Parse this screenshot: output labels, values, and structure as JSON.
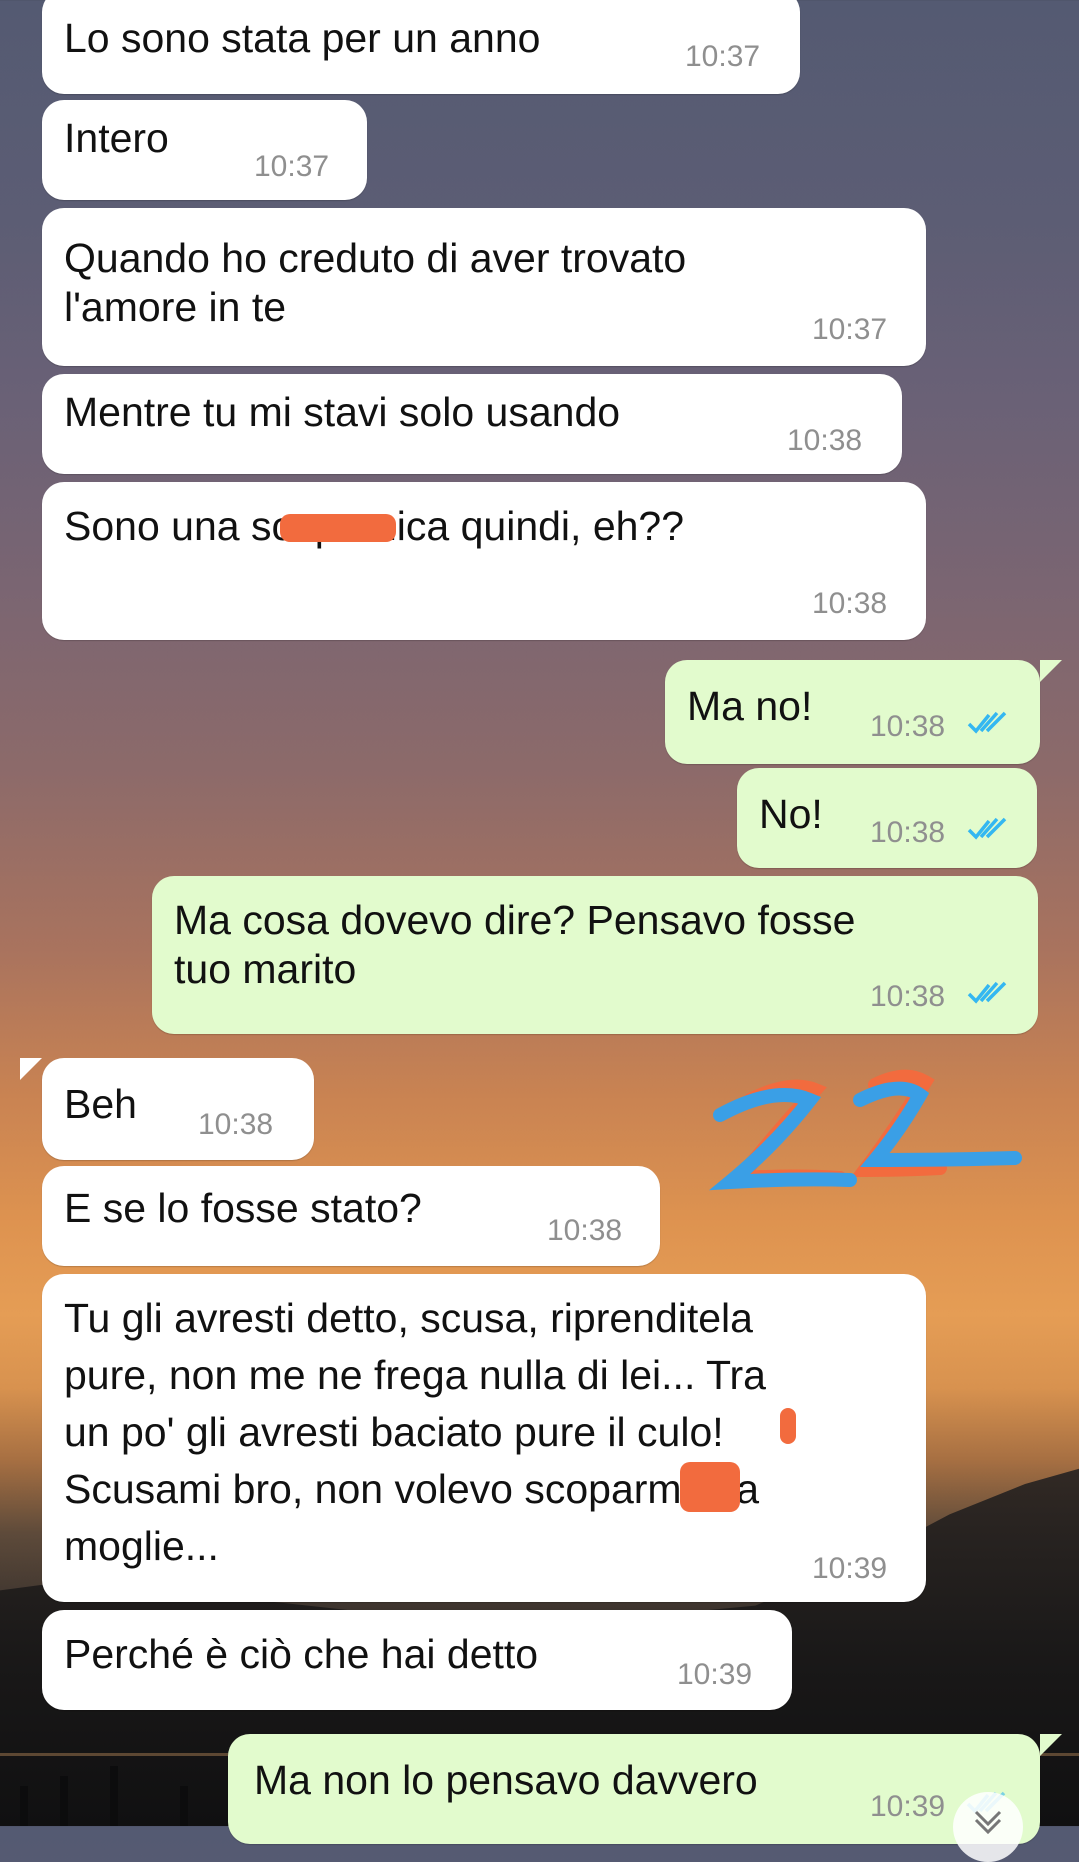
{
  "messages": [
    {
      "dir": "in",
      "text": "Lo sono stata per un anno",
      "time": "10:37"
    },
    {
      "dir": "in",
      "text": "Intero",
      "time": "10:37"
    },
    {
      "dir": "in",
      "text": "Quando ho creduto di aver trovato\nl'amore in te",
      "time": "10:37"
    },
    {
      "dir": "in",
      "text": "Mentre tu mi stavi solo usando",
      "time": "10:38"
    },
    {
      "dir": "in",
      "text": "Sono una scoparnica quindi, eh??",
      "time": "10:38"
    },
    {
      "dir": "out",
      "text": "Ma no!",
      "time": "10:38",
      "status": "read"
    },
    {
      "dir": "out",
      "text": "No!",
      "time": "10:38",
      "status": "read"
    },
    {
      "dir": "out",
      "text": "Ma cosa dovevo dire? Pensavo fosse\ntuo marito",
      "time": "10:38",
      "status": "read"
    },
    {
      "dir": "in",
      "text": "Beh",
      "time": "10:38"
    },
    {
      "dir": "in",
      "text": "E se lo fosse stato?",
      "time": "10:38"
    },
    {
      "dir": "in",
      "text": "Tu gli avresti detto, scusa, riprenditela\npure, non me ne frega nulla di lei... Tra\nun po' gli avresti baciato pure il culo!\nScusami bro, non volevo scoparmi tua\nmoglie...",
      "time": "10:39"
    },
    {
      "dir": "in",
      "text": "Perché è ciò che hai detto",
      "time": "10:39"
    },
    {
      "dir": "out",
      "text": "Ma non lo pensavo davvero",
      "time": "10:39",
      "status": "read"
    }
  ],
  "colors": {
    "incoming_bubble": "#ffffff",
    "outgoing_bubble": "#e2fbcd",
    "read_ticks": "#34b7f1",
    "redaction": "#f26b3e",
    "doodle_blue": "#3a9fe6"
  },
  "icons": {
    "read_receipt": "double-check-icon",
    "scroll_down": "chevron-down-icon"
  }
}
